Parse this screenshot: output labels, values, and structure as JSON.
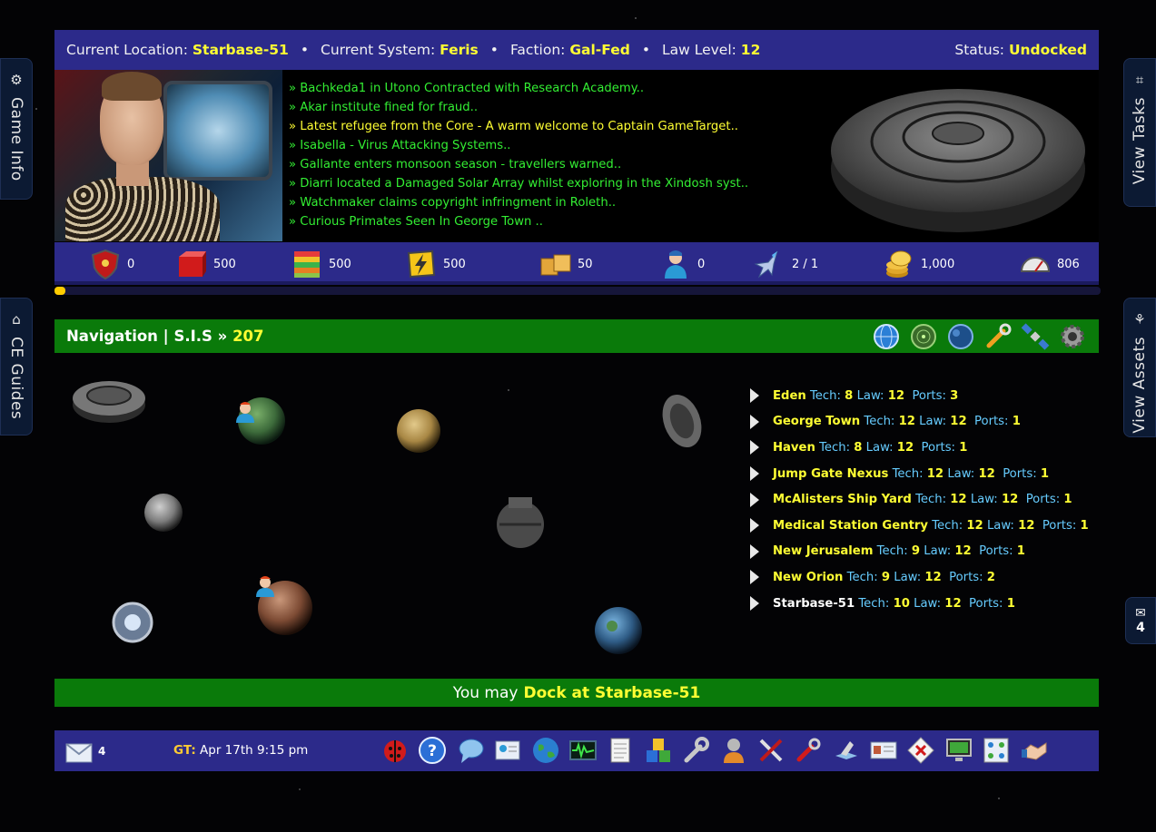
{
  "status": {
    "location_label": "Current Location:",
    "location_value": "Starbase-51",
    "system_label": "Current System:",
    "system_value": "Feris",
    "faction_label": "Faction:",
    "faction_value": "Gal-Fed",
    "law_label": "Law Level:",
    "law_value": "12",
    "status_label": "Status:",
    "status_value": "Undocked",
    "separator": "•"
  },
  "side_tabs": {
    "game_info": "Game Info",
    "ce_guides": "CE Guides",
    "view_tasks": "View Tasks",
    "view_assets": "View Assets"
  },
  "news": [
    "» Bachkeda1 in Utono Contracted with Research Academy..",
    "» Akar institute fined for fraud..",
    "» Latest refugee from the Core - A warm welcome to Captain GameTarget..",
    "» Isabella - Virus Attacking Systems..",
    "» Gallante enters monsoon season - travellers warned..",
    "» Diarri located a Damaged Solar Array whilst exploring in the Xindosh syst..",
    "» Watchmaker claims copyright infringment in Roleth..",
    "» Curious Primates Seen In George Town .."
  ],
  "resources": [
    {
      "icon": "shield-icon",
      "value": "0"
    },
    {
      "icon": "red-cargo-icon",
      "value": "500"
    },
    {
      "icon": "layered-books-icon",
      "value": "500"
    },
    {
      "icon": "energy-bolt-icon",
      "value": "500"
    },
    {
      "icon": "cargo-crates-icon",
      "value": "50"
    },
    {
      "icon": "crew-icon",
      "value": "0"
    },
    {
      "icon": "fighter-ship-icon",
      "value": "2 / 1"
    },
    {
      "icon": "credits-coins-icon",
      "value": "1,000"
    },
    {
      "icon": "speed-gauge-icon",
      "value": "806"
    }
  ],
  "progress_fraction": 0.01,
  "nav": {
    "title": "Navigation | S.I.S",
    "arrow": "»",
    "sector": "207"
  },
  "locations_labels": {
    "tech": "Tech:",
    "law": "Law:",
    "ports": "Ports:"
  },
  "locations": [
    {
      "name": "Eden",
      "tech": "8",
      "law": "12",
      "ports": "3",
      "current": false
    },
    {
      "name": "George Town",
      "tech": "12",
      "law": "12",
      "ports": "1",
      "current": false
    },
    {
      "name": "Haven",
      "tech": "8",
      "law": "12",
      "ports": "1",
      "current": false
    },
    {
      "name": "Jump Gate Nexus",
      "tech": "12",
      "law": "12",
      "ports": "1",
      "current": false
    },
    {
      "name": "McAlisters Ship Yard",
      "tech": "12",
      "law": "12",
      "ports": "1",
      "current": false
    },
    {
      "name": "Medical Station Gentry",
      "tech": "12",
      "law": "12",
      "ports": "1",
      "current": false
    },
    {
      "name": "New Jerusalem",
      "tech": "9",
      "law": "12",
      "ports": "1",
      "current": false
    },
    {
      "name": "New Orion",
      "tech": "9",
      "law": "12",
      "ports": "2",
      "current": false
    },
    {
      "name": "Starbase-51",
      "tech": "10",
      "law": "12",
      "ports": "1",
      "current": true
    }
  ],
  "dock": {
    "prefix": "You may",
    "action": "Dock at Starbase-51"
  },
  "mail_count": "4",
  "bottom": {
    "mail_count": "4",
    "gt_label": "GT:",
    "gt_value": "Apr 17th 9:15 pm"
  },
  "colors": {
    "bar_blue": "#2c2a8a",
    "nav_green": "#0a7a0a",
    "highlight_yellow": "#ffff33",
    "news_green": "#33ee33",
    "label_cyan": "#66ccff"
  }
}
